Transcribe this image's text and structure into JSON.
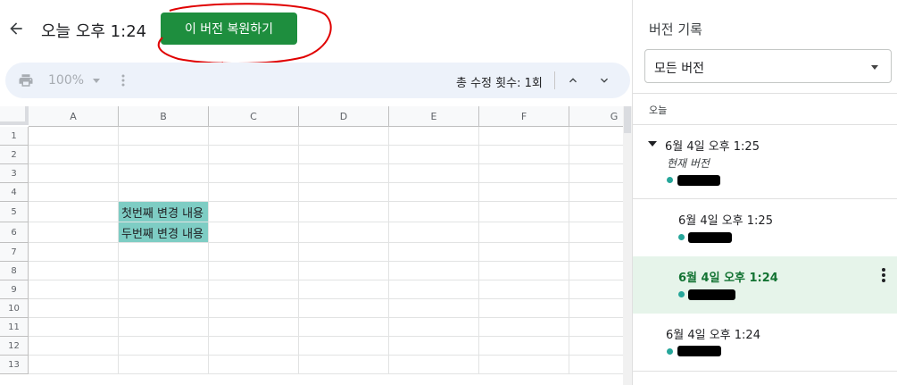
{
  "header": {
    "title": "오늘 오후 1:24",
    "restore_label": "이 버전 복원하기"
  },
  "toolbar": {
    "zoom": "100%",
    "edit_count": "총 수정 횟수: 1회"
  },
  "sheet": {
    "columns": [
      "A",
      "B",
      "C",
      "D",
      "E",
      "F",
      "G"
    ],
    "rows": [
      "1",
      "2",
      "3",
      "4",
      "5",
      "6",
      "7",
      "8",
      "9",
      "10",
      "11",
      "12",
      "13"
    ],
    "cells": {
      "b5": "첫번째 변경 내용",
      "b6": "두번째 변경 내용"
    },
    "highlight_color": "#7ecdc4"
  },
  "panel": {
    "title": "버전 기록",
    "filter_label": "모든 버전",
    "section_label": "오늘",
    "versions": [
      {
        "time": "6월 4일 오후 1:25",
        "sub": "현재 버전"
      },
      {
        "time": "6월 4일 오후 1:25"
      },
      {
        "time": "6월 4일 오후 1:24"
      },
      {
        "time": "6월 4일 오후 1:24"
      }
    ]
  },
  "colors": {
    "accent_green": "#1e8e3e",
    "selected_bg": "#e6f4ea",
    "user_dot": "#26a69a",
    "annotation": "#e00000"
  }
}
